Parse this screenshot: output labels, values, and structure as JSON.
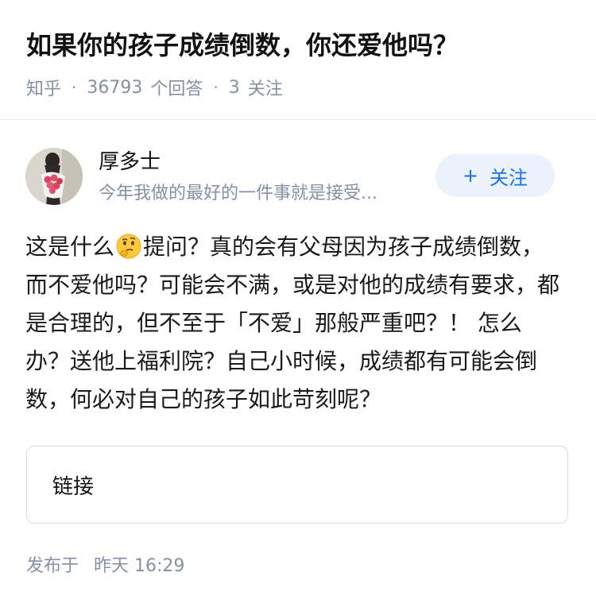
{
  "question": {
    "title": "如果你的孩子成绩倒数，你还爱他吗？",
    "source": "知乎",
    "separator": "·",
    "answer_count": "36793",
    "answer_label": "个回答",
    "follower_count": "3",
    "follower_label": "关注"
  },
  "author": {
    "name": "厚多士",
    "bio": "今年我做的最好的一件事就是接受...",
    "follow_label": "关注",
    "follow_icon": "plus-icon"
  },
  "answer": {
    "text_before_emoji": "这是什么",
    "emoji": "thinking-face-emoji",
    "text_after_emoji": "提问？真的会有父母因为孩子成绩倒数，而不爱他吗？可能会不满，或是对他的成绩有要求，都是合理的，但不至于「不爱」那般严重吧？！ 怎么办？送他上福利院？自己小时候，成绩都有可能会倒数，何必对自己的孩子如此苛刻呢？"
  },
  "link_card": {
    "label": "链接"
  },
  "footer": {
    "publish_label": "发布于",
    "publish_time": "昨天 16:29"
  },
  "colors": {
    "accent": "#1772f6",
    "follow_bg": "#ebf2fb",
    "meta_text": "#8590a6",
    "title_text": "#121212"
  }
}
